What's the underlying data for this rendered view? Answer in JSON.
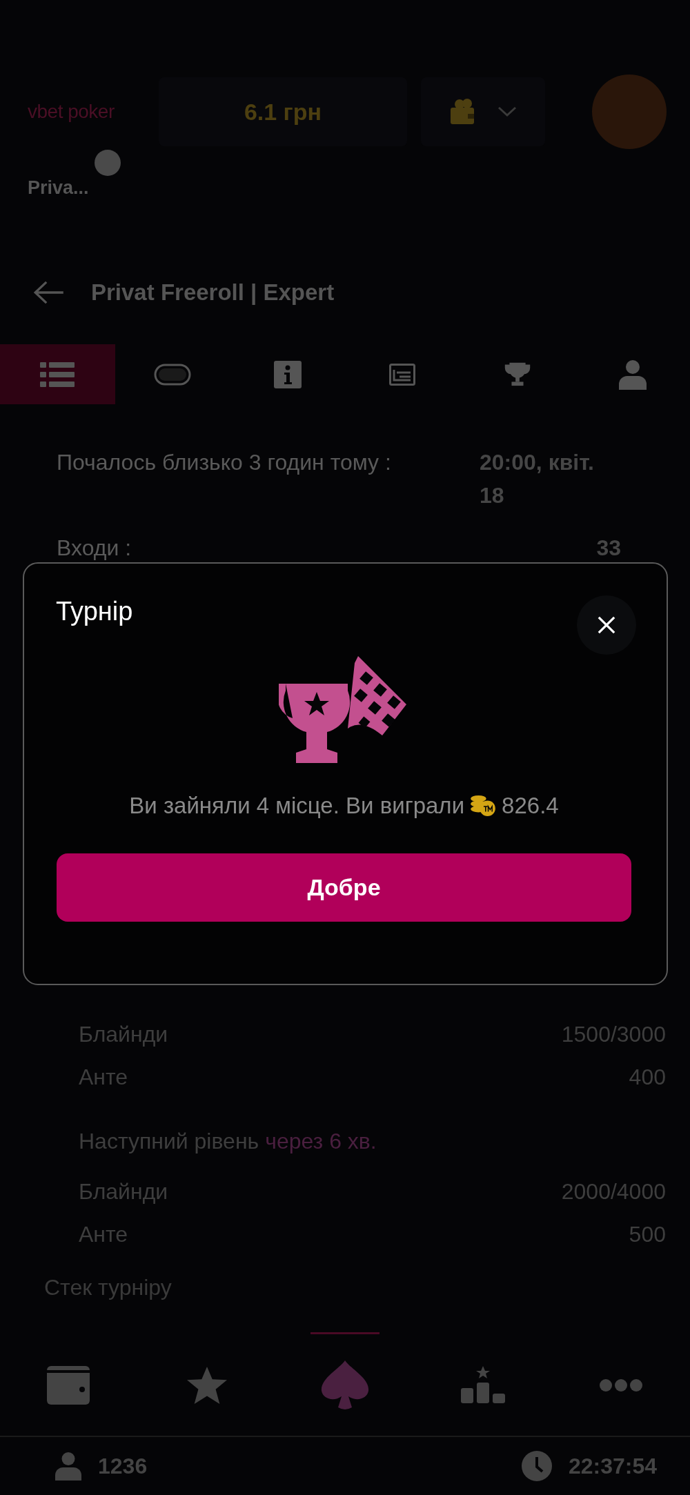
{
  "header": {
    "logo": "vbet poker",
    "balance": "6.1 грн"
  },
  "tournament_chip": {
    "label": "Priva..."
  },
  "title": "Privat Freeroll | Expert",
  "tabs": [
    {
      "kind": "list",
      "selected": true
    },
    {
      "kind": "table",
      "selected": false
    },
    {
      "kind": "info",
      "selected": false
    },
    {
      "kind": "blinds",
      "selected": false
    },
    {
      "kind": "prizes",
      "selected": false
    },
    {
      "kind": "players",
      "selected": false
    }
  ],
  "info": [
    {
      "label": "Почалось близько 3 годин тому :",
      "value": "20:00, квіт. 18"
    },
    {
      "label": "Входи :",
      "value": "33"
    }
  ],
  "current_level": [
    {
      "label": "Блайнди",
      "value": "1500/3000"
    },
    {
      "label": "Анте",
      "value": "400"
    }
  ],
  "next_level": {
    "label": "Наступний рівень",
    "countdown": "через 6 хв.",
    "rows": [
      {
        "label": "Блайнди",
        "value": "2000/4000"
      },
      {
        "label": "Анте",
        "value": "500"
      }
    ]
  },
  "stack_label": "Стек турніру",
  "modal": {
    "title": "Турнір",
    "message": "Ви зайняли 4 місце. Ви виграли",
    "amount": "826.4",
    "button": "Добре"
  },
  "bottom_nav": [
    {
      "kind": "wallet",
      "selected": false
    },
    {
      "kind": "favorites",
      "selected": false
    },
    {
      "kind": "poker",
      "selected": true
    },
    {
      "kind": "leaderboard",
      "selected": false
    },
    {
      "kind": "more",
      "selected": false
    }
  ],
  "status_bar": {
    "players_online": "1236",
    "time": "22:37:54"
  }
}
